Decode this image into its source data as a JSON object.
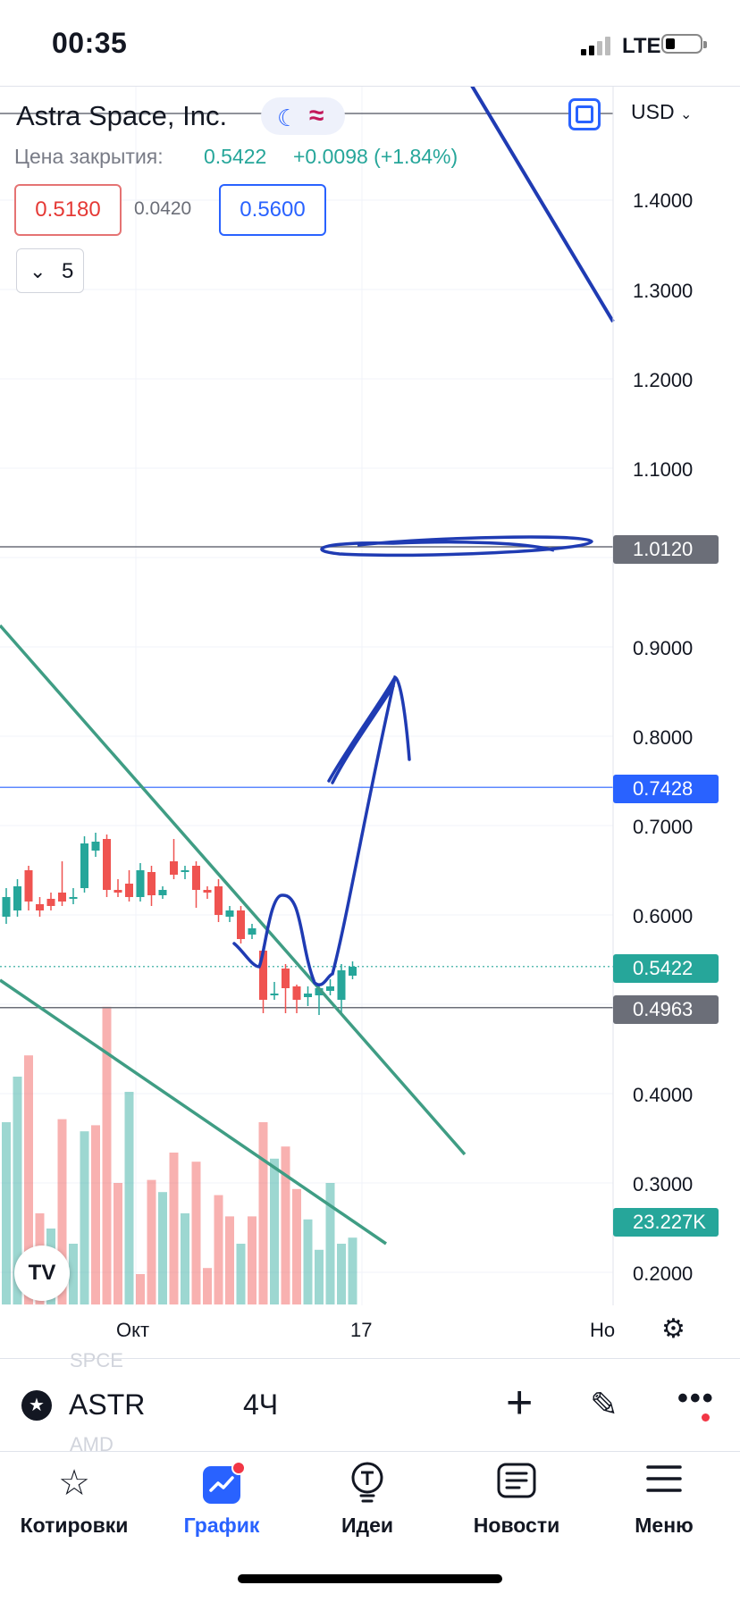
{
  "status_bar": {
    "time": "00:35",
    "network": "LTE"
  },
  "header": {
    "symbol_name": "Astra Space, Inc.",
    "currency": "USD",
    "close_label": "Цена закрытия:",
    "close_value": "0.5422",
    "close_change": "+0.0098 (+1.84%)",
    "bid": "0.5180",
    "spread": "0.0420",
    "ask": "0.5600",
    "indicators_count": "5"
  },
  "price_axis": [
    "1.4000",
    "1.3000",
    "1.2000",
    "1.1000",
    "0.9000",
    "0.8000",
    "0.7000",
    "0.6000",
    "0.4000",
    "0.3000",
    "0.2000"
  ],
  "price_tags": {
    "level_1": "1.0120",
    "level_2": "0.7428",
    "current": "0.5422",
    "level_3": "0.4963",
    "volume": "23.227K"
  },
  "time_axis": [
    "Окт",
    "17",
    "Но"
  ],
  "symbol_bar": {
    "ticker": "ASTR",
    "interval": "4Ч",
    "faded_above": "SPCE",
    "faded_below": "AMD"
  },
  "tabs": [
    {
      "label": "Котировки",
      "icon": "star-icon"
    },
    {
      "label": "График",
      "icon": "chart-icon"
    },
    {
      "label": "Идеи",
      "icon": "lightbulb-icon"
    },
    {
      "label": "Новости",
      "icon": "newspaper-icon"
    },
    {
      "label": "Меню",
      "icon": "hamburger-icon"
    }
  ],
  "colors": {
    "up": "#26a69a",
    "down": "#ef5350",
    "accent": "#2962ff",
    "drawing": "#1f3bb3",
    "trendline": "#3f9d84"
  },
  "chart_data": {
    "type": "candlestick",
    "y_axis_ticks": [
      1.4,
      1.3,
      1.2,
      1.1,
      0.9,
      0.8,
      0.7,
      0.6,
      0.4,
      0.3,
      0.2
    ],
    "horizontal_levels": [
      1.012,
      0.7428,
      0.4963
    ],
    "last_price": 0.5422,
    "last_volume": "23.227K",
    "x_labels": [
      "Окт",
      "17",
      "Но"
    ],
    "candles": [
      {
        "o": 0.598,
        "c": 0.62,
        "h": 0.63,
        "l": 0.59
      },
      {
        "o": 0.605,
        "c": 0.632,
        "h": 0.64,
        "l": 0.598
      },
      {
        "o": 0.65,
        "c": 0.615,
        "h": 0.655,
        "l": 0.605
      },
      {
        "o": 0.612,
        "c": 0.605,
        "h": 0.62,
        "l": 0.598
      },
      {
        "o": 0.618,
        "c": 0.61,
        "h": 0.625,
        "l": 0.605
      },
      {
        "o": 0.625,
        "c": 0.615,
        "h": 0.66,
        "l": 0.61
      },
      {
        "o": 0.618,
        "c": 0.62,
        "h": 0.63,
        "l": 0.612
      },
      {
        "o": 0.63,
        "c": 0.68,
        "h": 0.688,
        "l": 0.625
      },
      {
        "o": 0.672,
        "c": 0.682,
        "h": 0.692,
        "l": 0.665
      },
      {
        "o": 0.685,
        "c": 0.628,
        "h": 0.69,
        "l": 0.62
      },
      {
        "o": 0.628,
        "c": 0.625,
        "h": 0.64,
        "l": 0.62
      },
      {
        "o": 0.635,
        "c": 0.62,
        "h": 0.65,
        "l": 0.615
      },
      {
        "o": 0.62,
        "c": 0.65,
        "h": 0.658,
        "l": 0.615
      },
      {
        "o": 0.648,
        "c": 0.622,
        "h": 0.655,
        "l": 0.61
      },
      {
        "o": 0.622,
        "c": 0.628,
        "h": 0.632,
        "l": 0.618
      },
      {
        "o": 0.66,
        "c": 0.645,
        "h": 0.685,
        "l": 0.64
      },
      {
        "o": 0.648,
        "c": 0.65,
        "h": 0.655,
        "l": 0.64
      },
      {
        "o": 0.655,
        "c": 0.628,
        "h": 0.66,
        "l": 0.608
      },
      {
        "o": 0.628,
        "c": 0.625,
        "h": 0.632,
        "l": 0.618
      },
      {
        "o": 0.632,
        "c": 0.6,
        "h": 0.64,
        "l": 0.592
      },
      {
        "o": 0.598,
        "c": 0.605,
        "h": 0.61,
        "l": 0.592
      },
      {
        "o": 0.605,
        "c": 0.573,
        "h": 0.61,
        "l": 0.568
      },
      {
        "o": 0.578,
        "c": 0.585,
        "h": 0.59,
        "l": 0.573
      },
      {
        "o": 0.56,
        "c": 0.505,
        "h": 0.565,
        "l": 0.49
      },
      {
        "o": 0.51,
        "c": 0.512,
        "h": 0.525,
        "l": 0.505
      },
      {
        "o": 0.54,
        "c": 0.518,
        "h": 0.545,
        "l": 0.49
      },
      {
        "o": 0.52,
        "c": 0.505,
        "h": 0.522,
        "l": 0.49
      },
      {
        "o": 0.508,
        "c": 0.512,
        "h": 0.52,
        "l": 0.498
      },
      {
        "o": 0.51,
        "c": 0.518,
        "h": 0.522,
        "l": 0.488
      },
      {
        "o": 0.515,
        "c": 0.52,
        "h": 0.528,
        "l": 0.51
      },
      {
        "o": 0.505,
        "c": 0.538,
        "h": 0.545,
        "l": 0.49
      },
      {
        "o": 0.532,
        "c": 0.542,
        "h": 0.548,
        "l": 0.528
      }
    ],
    "volume": [
      {
        "v": 0.6,
        "up": true
      },
      {
        "v": 0.75,
        "up": true
      },
      {
        "v": 0.82,
        "up": false
      },
      {
        "v": 0.3,
        "up": false
      },
      {
        "v": 0.25,
        "up": true
      },
      {
        "v": 0.61,
        "up": false
      },
      {
        "v": 0.2,
        "up": true
      },
      {
        "v": 0.57,
        "up": true
      },
      {
        "v": 0.59,
        "up": false
      },
      {
        "v": 0.98,
        "up": false
      },
      {
        "v": 0.4,
        "up": false
      },
      {
        "v": 0.7,
        "up": true
      },
      {
        "v": 0.1,
        "up": false
      },
      {
        "v": 0.41,
        "up": false
      },
      {
        "v": 0.37,
        "up": true
      },
      {
        "v": 0.5,
        "up": false
      },
      {
        "v": 0.3,
        "up": true
      },
      {
        "v": 0.47,
        "up": false
      },
      {
        "v": 0.12,
        "up": false
      },
      {
        "v": 0.36,
        "up": false
      },
      {
        "v": 0.29,
        "up": false
      },
      {
        "v": 0.2,
        "up": true
      },
      {
        "v": 0.29,
        "up": false
      },
      {
        "v": 0.6,
        "up": false
      },
      {
        "v": 0.48,
        "up": true
      },
      {
        "v": 0.52,
        "up": false
      },
      {
        "v": 0.38,
        "up": false
      },
      {
        "v": 0.28,
        "up": true
      },
      {
        "v": 0.18,
        "up": true
      },
      {
        "v": 0.4,
        "up": true
      },
      {
        "v": 0.2,
        "up": true
      },
      {
        "v": 0.22,
        "up": true
      }
    ]
  }
}
